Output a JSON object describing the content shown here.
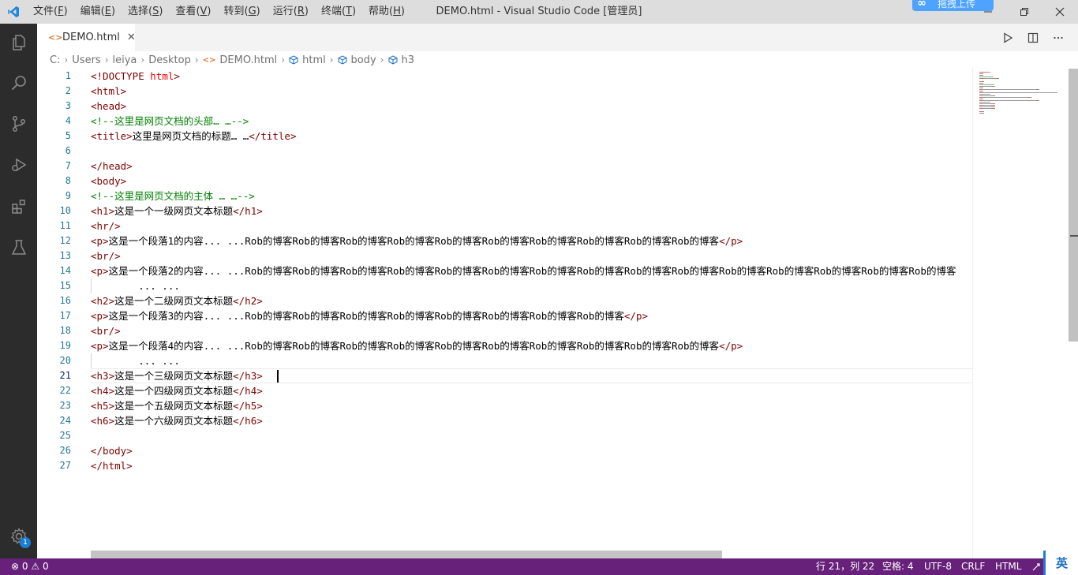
{
  "window": {
    "title": "DEMO.html - Visual Studio Code [管理员]",
    "menu": [
      {
        "label": "文件(",
        "acc": "F",
        "end": ")"
      },
      {
        "label": "编辑(",
        "acc": "E",
        "end": ")"
      },
      {
        "label": "选择(",
        "acc": "S",
        "end": ")"
      },
      {
        "label": "查看(",
        "acc": "V",
        "end": ")"
      },
      {
        "label": "转到(",
        "acc": "G",
        "end": ")"
      },
      {
        "label": "运行(",
        "acc": "R",
        "end": ")"
      },
      {
        "label": "终端(",
        "acc": "T",
        "end": ")"
      },
      {
        "label": "帮助(",
        "acc": "H",
        "end": ")"
      }
    ],
    "upload_badge": "拖拽上传",
    "buttons": [
      "minimize",
      "restore",
      "close"
    ]
  },
  "activity_bar": {
    "items": [
      "explorer-icon",
      "search-icon",
      "source-control-icon",
      "run-debug-icon",
      "extensions-icon",
      "testing-icon"
    ],
    "settings_badge": "1"
  },
  "tabs": [
    {
      "label": "DEMO.html",
      "icon": "html-file-icon",
      "active": true
    }
  ],
  "breadcrumb": [
    "C:",
    "Users",
    "leiya",
    "Desktop",
    "DEMO.html",
    "html",
    "body",
    "h3"
  ],
  "editor": {
    "current_line": 21,
    "lines": [
      [
        [
          "t",
          "<!DOCTYPE "
        ],
        [
          "a",
          "html"
        ],
        [
          "t",
          ">"
        ]
      ],
      [
        [
          "t",
          "<html>"
        ]
      ],
      [
        [
          "t",
          "<head>"
        ]
      ],
      [
        [
          "c",
          "<!--这里是网页文档的头部… …-->"
        ]
      ],
      [
        [
          "t",
          "<title>"
        ],
        [
          "x",
          "这里是网页文档的标题… …"
        ],
        [
          "t",
          "</title>"
        ]
      ],
      [],
      [
        [
          "t",
          "</head>"
        ]
      ],
      [
        [
          "t",
          "<body>"
        ]
      ],
      [
        [
          "c",
          "<!--这里是网页文档的主体 … …-->"
        ]
      ],
      [
        [
          "t",
          "<h1>"
        ],
        [
          "x",
          "这是一个一级网页文本标题"
        ],
        [
          "t",
          "</h1>"
        ]
      ],
      [
        [
          "t",
          "<hr/>"
        ]
      ],
      [
        [
          "t",
          "<p>"
        ],
        [
          "x",
          "这是一个段落1的内容... ...Rob的博客Rob的博客Rob的博客Rob的博客Rob的博客Rob的博客Rob的博客Rob的博客Rob的博客Rob的博客"
        ],
        [
          "t",
          "</p>"
        ]
      ],
      [
        [
          "t",
          "<br/>"
        ]
      ],
      [
        [
          "t",
          "<p>"
        ],
        [
          "x",
          "这是一个段落2的内容... ...Rob的博客Rob的博客Rob的博客Rob的博客Rob的博客Rob的博客Rob的博客Rob的博客Rob的博客Rob的博客Rob的博客Rob的博客Rob的博客Rob的博客Rob的博客"
        ]
      ],
      [
        [
          "x",
          "        ... ..."
        ]
      ],
      [
        [
          "t",
          "<h2>"
        ],
        [
          "x",
          "这是一个二级网页文本标题"
        ],
        [
          "t",
          "</h2>"
        ]
      ],
      [
        [
          "t",
          "<p>"
        ],
        [
          "x",
          "这是一个段落3的内容... ...Rob的博客Rob的博客Rob的博客Rob的博客Rob的博客Rob的博客Rob的博客Rob的博客"
        ],
        [
          "t",
          "</p>"
        ]
      ],
      [
        [
          "t",
          "<br/>"
        ]
      ],
      [
        [
          "t",
          "<p>"
        ],
        [
          "x",
          "这是一个段落4的内容... ...Rob的博客Rob的博客Rob的博客Rob的博客Rob的博客Rob的博客Rob的博客Rob的博客Rob的博客Rob的博客"
        ],
        [
          "t",
          "</p>"
        ]
      ],
      [
        [
          "x",
          "        ... ..."
        ]
      ],
      [
        [
          "t",
          "<h3>"
        ],
        [
          "x",
          "这是一个三级网页文本标题"
        ],
        [
          "t",
          "</h3>"
        ]
      ],
      [
        [
          "t",
          "<h4>"
        ],
        [
          "x",
          "这是一个四级网页文本标题"
        ],
        [
          "t",
          "</h4>"
        ]
      ],
      [
        [
          "t",
          "<h5>"
        ],
        [
          "x",
          "这是一个五级网页文本标题"
        ],
        [
          "t",
          "</h5>"
        ]
      ],
      [
        [
          "t",
          "<h6>"
        ],
        [
          "x",
          "这是一个六级网页文本标题"
        ],
        [
          "t",
          "</h6>"
        ]
      ],
      [],
      [
        [
          "t",
          "</body>"
        ]
      ],
      [
        [
          "t",
          "</html>"
        ]
      ]
    ]
  },
  "status": {
    "errors": "0",
    "warnings": "0",
    "position": "行 21，列 22",
    "spaces": "空格: 4",
    "encoding": "UTF-8",
    "eol": "CRLF",
    "language": "HTML",
    "ime": "英"
  },
  "colors": {
    "status_bar": "#68217a",
    "activity_bar": "#2c2c2c",
    "tag": "#800000",
    "attribute": "#e50000",
    "comment": "#008000",
    "line_number": "#237893"
  }
}
